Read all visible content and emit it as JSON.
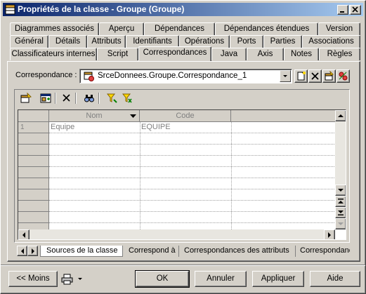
{
  "window": {
    "title": "Propriétés de la classe - Groupe (Groupe)",
    "controls": {
      "minimize": "_",
      "maximize": "□",
      "close": "×"
    }
  },
  "tabs": {
    "row1": [
      "Diagrammes associés",
      "Aperçu",
      "Dépendances",
      "Dépendances étendues",
      "Version"
    ],
    "row2": [
      "Général",
      "Détails",
      "Attributs",
      "Identifiants",
      "Opérations",
      "Ports",
      "Parties",
      "Associations"
    ],
    "row3": [
      "Classificateurs internes",
      "Script",
      "Correspondances",
      "Java",
      "Axis",
      "Notes",
      "Règles"
    ],
    "active": "Correspondances"
  },
  "mapping": {
    "label": "Correspondance :",
    "selected": "SrceDonnees.Groupe.Correspondance_1",
    "side_buttons": [
      "new-icon",
      "delete-icon",
      "properties-icon",
      "link-icon"
    ]
  },
  "toolbar": {
    "icons": [
      "properties-icon",
      "add-objects-icon",
      "delete-icon",
      "find-icon",
      "filter-icon",
      "clear-filter-icon"
    ]
  },
  "grid": {
    "columns": [
      "Nom",
      "Code"
    ],
    "rows": [
      {
        "num": "1",
        "nom": "Equipe",
        "code": "EQUIPE"
      }
    ]
  },
  "subtabs": [
    "Sources de la classe",
    "Correspond à",
    "Correspondances des attributs",
    "Correspondanc"
  ],
  "buttons": {
    "less": "<< Moins",
    "ok": "OK",
    "cancel": "Annuler",
    "apply": "Appliquer",
    "help": "Aide"
  },
  "colors": {
    "face": "#d4d0c8",
    "title_start": "#0a246a",
    "title_end": "#a6caf0",
    "disabled_text": "#808080"
  }
}
